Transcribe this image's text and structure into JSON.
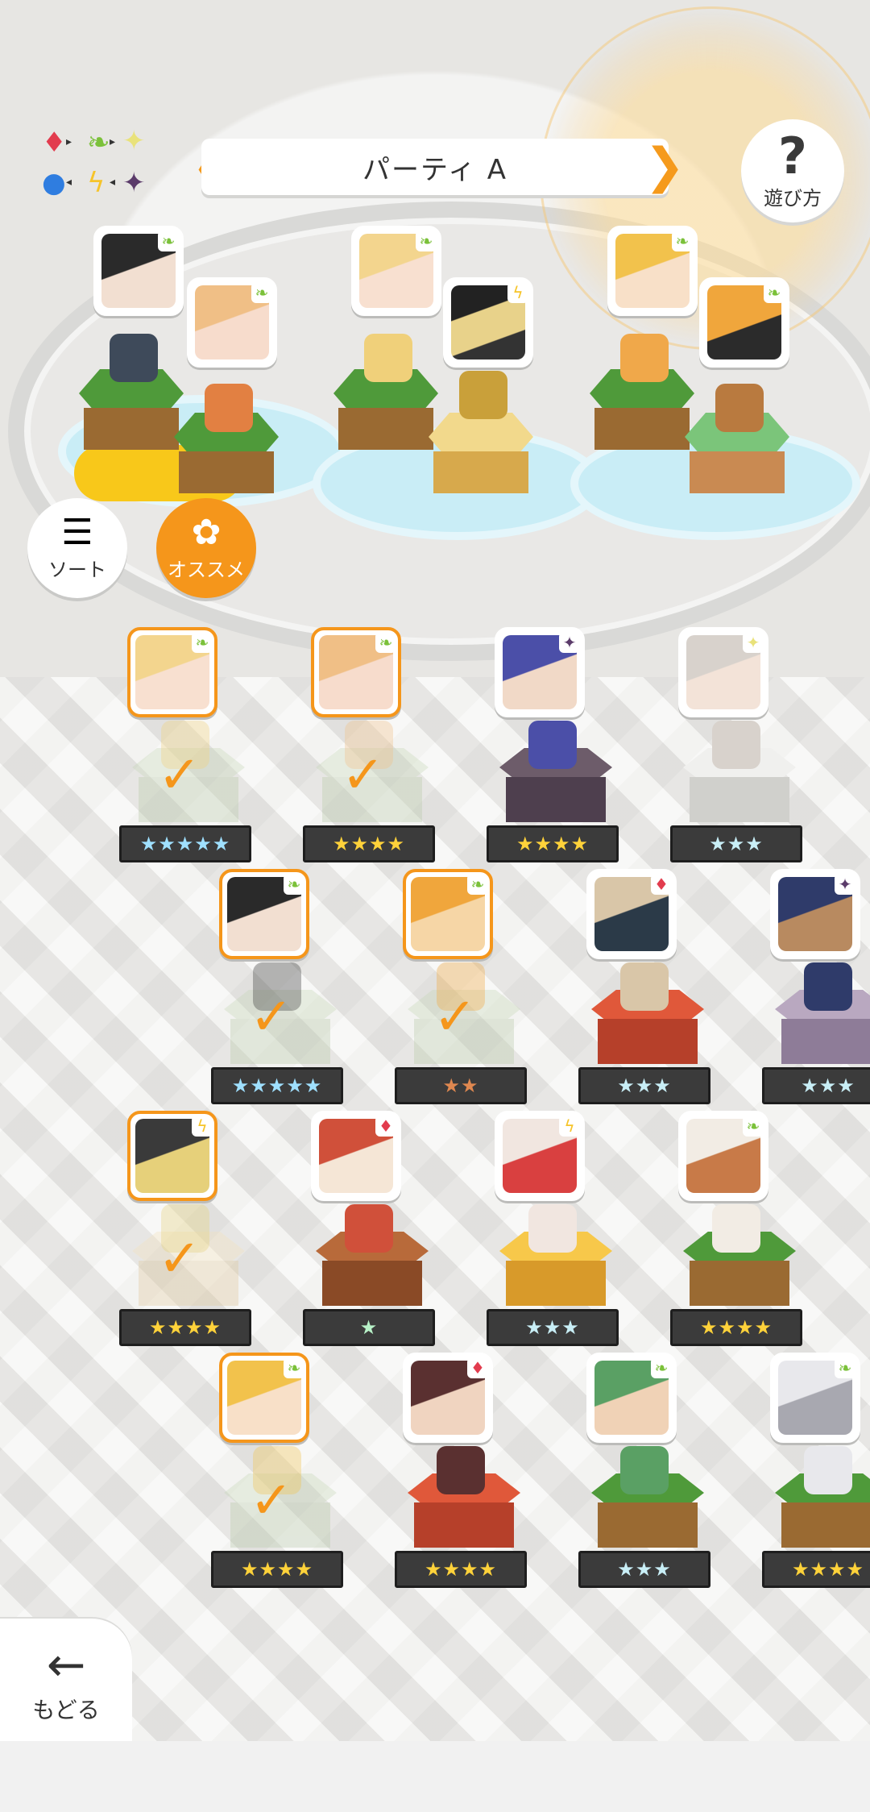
{
  "header": {
    "party_name": "パーティ A",
    "prev_icon": "chevron-left-icon",
    "next_icon": "chevron-right-icon",
    "help_label": "遊び方",
    "help_symbol": "?"
  },
  "element_chart": {
    "icons": [
      "fire-diamond-icon",
      "leaf-icon",
      "light-star-icon",
      "water-circle-icon",
      "thunder-bolt-icon",
      "dark-star-icon"
    ]
  },
  "buttons": {
    "sort_label": "ソート",
    "recommend_label": "オススメ",
    "back_label": "もどる"
  },
  "colors": {
    "accent": "#f5961b",
    "grass": "#4f9a3a",
    "water_plate": "#c9edf6"
  },
  "party_slots": [
    {
      "members": [
        {
          "element": "wind"
        },
        {
          "element": "wind"
        }
      ],
      "leader_highlight": true
    },
    {
      "members": [
        {
          "element": "wind"
        },
        {
          "element": "thunder"
        }
      ]
    },
    {
      "members": [
        {
          "element": "wind"
        },
        {
          "element": "wind"
        }
      ]
    }
  ],
  "roster": [
    {
      "element": "wind",
      "selected": true,
      "stars": "★★★★★",
      "star_style": "rainbow"
    },
    {
      "element": "wind",
      "selected": true,
      "stars": "★★★★",
      "star_style": "gold"
    },
    {
      "element": "dark",
      "selected": false,
      "stars": "★★★★",
      "star_style": "gold"
    },
    {
      "element": "light",
      "selected": false,
      "stars": "★★★",
      "star_style": "silver"
    },
    {
      "element": "wind",
      "selected": true,
      "stars": "★★★★★",
      "star_style": "rainbow"
    },
    {
      "element": "wind",
      "selected": true,
      "stars": "★★",
      "star_style": "bronze"
    },
    {
      "element": "fire",
      "selected": false,
      "stars": "★★★",
      "star_style": "silver"
    },
    {
      "element": "dark",
      "selected": false,
      "stars": "★★★",
      "star_style": "silver"
    },
    {
      "element": "thunder",
      "selected": true,
      "stars": "★★★★",
      "star_style": "gold"
    },
    {
      "element": "fire",
      "selected": false,
      "stars": "★",
      "star_style": "green"
    },
    {
      "element": "thunder",
      "selected": false,
      "stars": "★★★",
      "star_style": "silver"
    },
    {
      "element": "wind",
      "selected": false,
      "stars": "★★★★",
      "star_style": "gold"
    },
    {
      "element": "wind",
      "selected": true,
      "stars": "★★★★",
      "star_style": "gold"
    },
    {
      "element": "fire",
      "selected": false,
      "stars": "★★★★",
      "star_style": "gold"
    },
    {
      "element": "wind",
      "selected": false,
      "stars": "★★★",
      "star_style": "silver"
    },
    {
      "element": "wind",
      "selected": false,
      "stars": "★★★★",
      "star_style": "gold"
    }
  ]
}
